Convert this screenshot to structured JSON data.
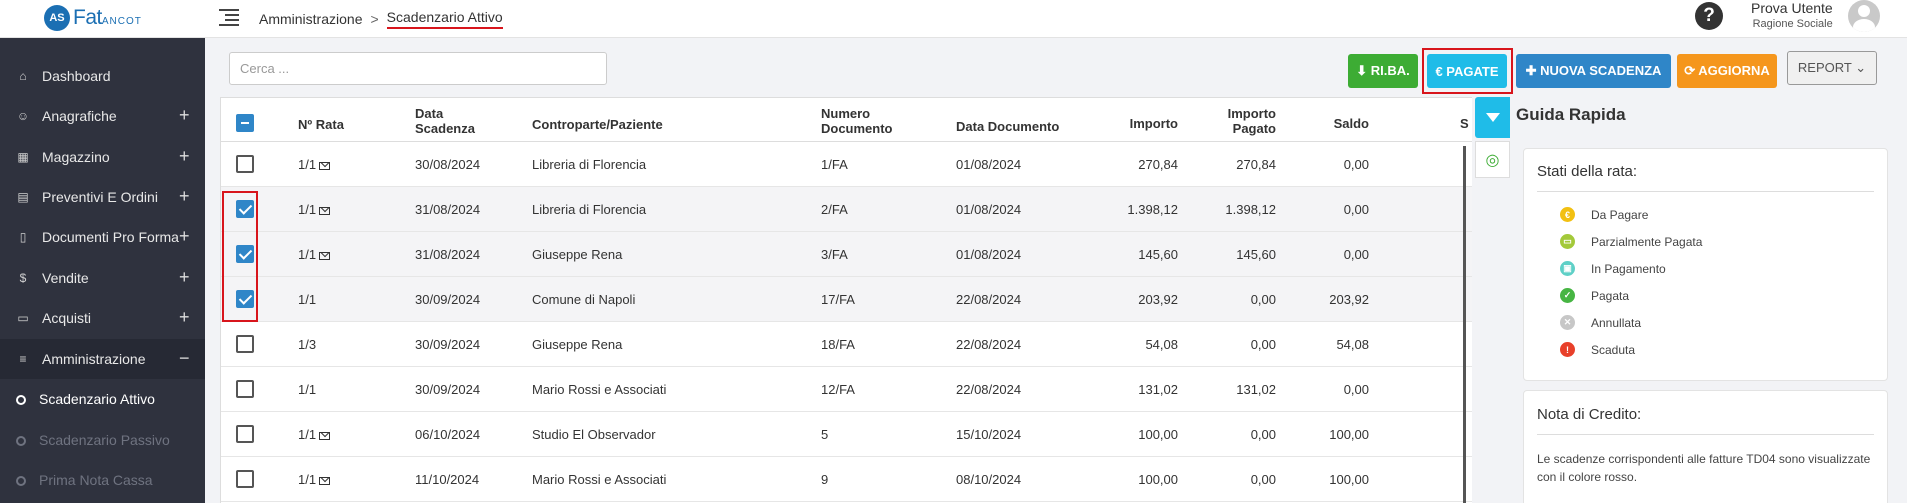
{
  "app": {
    "logo_text": "Fat",
    "logo_suffix": "ANCOT",
    "logo_mark": "AS"
  },
  "breadcrumb": {
    "root": "Amministrazione",
    "sep": ">",
    "current": "Scadenzario Attivo"
  },
  "user": {
    "name": "Prova Utente",
    "role": "Ragione Sociale",
    "help": "?"
  },
  "sidebar": {
    "items": [
      {
        "label": "Dashboard",
        "icon": "home-icon",
        "glyph": "⌂",
        "plus": ""
      },
      {
        "label": "Anagrafiche",
        "icon": "user-icon",
        "glyph": "☺",
        "plus": "+"
      },
      {
        "label": "Magazzino",
        "icon": "warehouse-icon",
        "glyph": "▦",
        "plus": "+"
      },
      {
        "label": "Preventivi E Ordini",
        "icon": "clipboard-icon",
        "glyph": "▤",
        "plus": "+"
      },
      {
        "label": "Documenti Pro Forma",
        "icon": "document-icon",
        "glyph": "▯",
        "plus": "+"
      },
      {
        "label": "Vendite",
        "icon": "dollar-icon",
        "glyph": "$",
        "plus": "+"
      },
      {
        "label": "Acquisti",
        "icon": "wallet-icon",
        "glyph": "▭",
        "plus": "+"
      },
      {
        "label": "Amministrazione",
        "icon": "database-icon",
        "glyph": "≡",
        "plus": "−"
      },
      {
        "label": "Scadenzario Attivo",
        "icon": "circle-icon",
        "glyph": "",
        "plus": ""
      },
      {
        "label": "Scadenzario Passivo",
        "icon": "circle-icon",
        "glyph": "",
        "plus": ""
      },
      {
        "label": "Prima Nota Cassa",
        "icon": "circle-icon",
        "glyph": "",
        "plus": ""
      }
    ]
  },
  "search": {
    "placeholder": "Cerca ..."
  },
  "toolbar": {
    "riba": "⬇ RI.BA.",
    "pagate": "€ PAGATE",
    "nuova": "✚ NUOVA SCADENZA",
    "aggiorna": "⟳ AGGIORNA",
    "report": "REPORT  ⌄"
  },
  "table": {
    "headers": [
      "Nº Rata",
      "Data Scadenza",
      "Controparte/Paziente",
      "Numero Documento",
      "Data Documento",
      "Importo",
      "Importo Pagato",
      "Saldo",
      "S"
    ],
    "rows": [
      {
        "rata": "1/1",
        "mail": true,
        "scad": "30/08/2024",
        "contro": "Libreria di Florencia",
        "num": "1/FA",
        "datadoc": "01/08/2024",
        "imp": "270,84",
        "pag": "270,84",
        "saldo": "0,00",
        "checked": false
      },
      {
        "rata": "1/1",
        "mail": true,
        "scad": "31/08/2024",
        "contro": "Libreria di Florencia",
        "num": "2/FA",
        "datadoc": "01/08/2024",
        "imp": "1.398,12",
        "pag": "1.398,12",
        "saldo": "0,00",
        "checked": true
      },
      {
        "rata": "1/1",
        "mail": true,
        "scad": "31/08/2024",
        "contro": "Giuseppe Rena",
        "num": "3/FA",
        "datadoc": "01/08/2024",
        "imp": "145,60",
        "pag": "145,60",
        "saldo": "0,00",
        "checked": true
      },
      {
        "rata": "1/1",
        "mail": false,
        "scad": "30/09/2024",
        "contro": "Comune di Napoli",
        "num": "17/FA",
        "datadoc": "22/08/2024",
        "imp": "203,92",
        "pag": "0,00",
        "saldo": "203,92",
        "checked": true
      },
      {
        "rata": "1/3",
        "mail": false,
        "scad": "30/09/2024",
        "contro": "Giuseppe Rena",
        "num": "18/FA",
        "datadoc": "22/08/2024",
        "imp": "54,08",
        "pag": "0,00",
        "saldo": "54,08",
        "checked": false
      },
      {
        "rata": "1/1",
        "mail": false,
        "scad": "30/09/2024",
        "contro": "Mario Rossi e Associati",
        "num": "12/FA",
        "datadoc": "22/08/2024",
        "imp": "131,02",
        "pag": "131,02",
        "saldo": "0,00",
        "checked": false
      },
      {
        "rata": "1/1",
        "mail": true,
        "scad": "06/10/2024",
        "contro": "Studio El Observador",
        "num": "5",
        "datadoc": "15/10/2024",
        "imp": "100,00",
        "pag": "0,00",
        "saldo": "100,00",
        "checked": false
      },
      {
        "rata": "1/1",
        "mail": true,
        "scad": "11/10/2024",
        "contro": "Mario Rossi e Associati",
        "num": "9",
        "datadoc": "08/10/2024",
        "imp": "100,00",
        "pag": "0,00",
        "saldo": "100,00",
        "checked": false
      }
    ]
  },
  "guide": {
    "title": "Guida Rapida",
    "states_title": "Stati della rata:",
    "states": [
      {
        "label": "Da Pagare",
        "color": "#f2c012",
        "glyph": "€"
      },
      {
        "label": "Parzialmente Pagata",
        "color": "#a3c93a",
        "glyph": "▭"
      },
      {
        "label": "In Pagamento",
        "color": "#5fd0c7",
        "glyph": "▣"
      },
      {
        "label": "Pagata",
        "color": "#47b543",
        "glyph": "✓"
      },
      {
        "label": "Annullata",
        "color": "#c7c7c7",
        "glyph": "✕"
      },
      {
        "label": "Scaduta",
        "color": "#e8402a",
        "glyph": "!"
      }
    ],
    "credit_title": "Nota di Credito:",
    "credit_text": "Le scadenze corrispondenti alle fatture TD04 sono visualizzate con il colore rosso."
  }
}
